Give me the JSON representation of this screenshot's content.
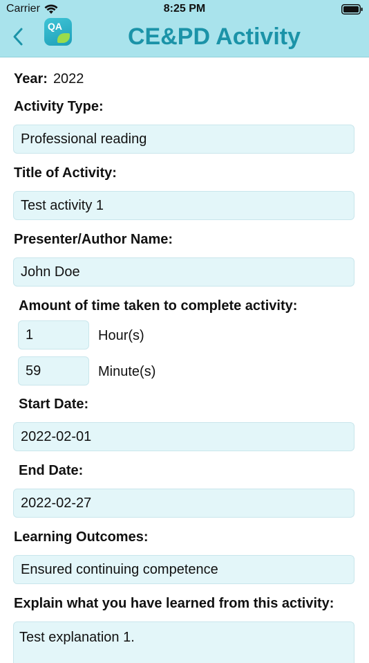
{
  "status_bar": {
    "carrier": "Carrier",
    "time": "8:25 PM"
  },
  "nav": {
    "title": "CE&PD Activity",
    "logo_text": "QA",
    "accent_color": "#1b93a8",
    "bar_color": "#a9e3ec"
  },
  "form": {
    "year_label": "Year:",
    "year_value": "2022",
    "activity_type_label": "Activity Type:",
    "activity_type_value": "Professional reading",
    "title_label": "Title of Activity:",
    "title_value": "Test activity 1",
    "presenter_label": "Presenter/Author Name:",
    "presenter_value": "John Doe",
    "time_label": "Amount of time taken to complete activity:",
    "hours_value": "1",
    "hours_unit": "Hour(s)",
    "minutes_value": "59",
    "minutes_unit": "Minute(s)",
    "start_date_label": "Start Date:",
    "start_date_value": "2022-02-01",
    "end_date_label": "End Date:",
    "end_date_value": "2022-02-27",
    "outcomes_label": "Learning Outcomes:",
    "outcomes_value": "Ensured continuing competence",
    "explain_label": "Explain what you have learned from this activity:",
    "explain_value": "Test explanation 1."
  }
}
